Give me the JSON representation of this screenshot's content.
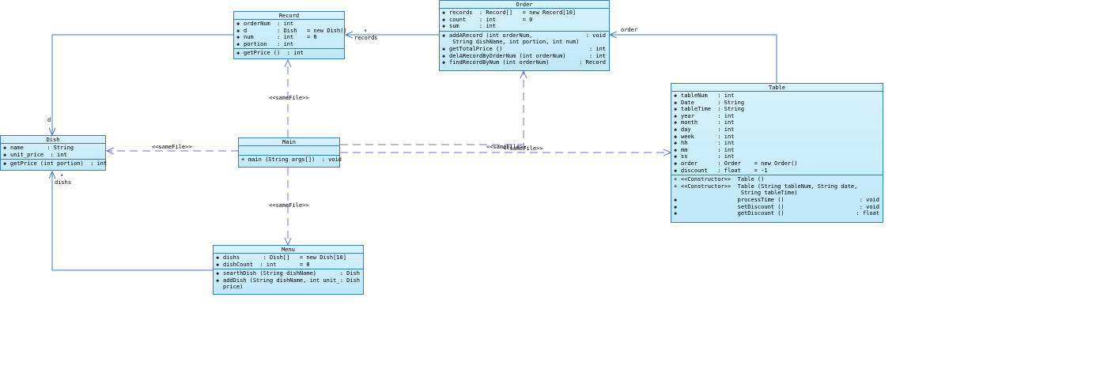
{
  "classes": {
    "record": {
      "name": "Record",
      "attrs": [
        {
          "vis": "◈",
          "text": "orderNum  : int"
        },
        {
          "vis": "◈",
          "text": "d         : Dish   = new Dish()"
        },
        {
          "vis": "◈",
          "text": "num       : int    = 0"
        },
        {
          "vis": "◈",
          "text": "portion   : int"
        }
      ],
      "ops": [
        {
          "vis": "◈",
          "text": "getPrice ()  : int"
        }
      ]
    },
    "order": {
      "name": "Order",
      "attrs": [
        {
          "vis": "◈",
          "text": "records  : Record[]   = new Record[10]"
        },
        {
          "vis": "◈",
          "text": "count    : int        = 0"
        },
        {
          "vis": "◈",
          "text": "sum      : int"
        }
      ],
      "ops": [
        {
          "vis": "◈",
          "text": "addARecord (int orderNum,",
          "ret": ": void"
        },
        {
          "vis": "",
          "text": " String dishName, int portion, int num)",
          "ret": ""
        },
        {
          "vis": "◈",
          "text": "getTotalPrice ()",
          "ret": ": int"
        },
        {
          "vis": "◈",
          "text": "delARecordByOrderNum (int orderNum)",
          "ret": ": int"
        },
        {
          "vis": "◈",
          "text": "findRecordByNum (int orderNum)",
          "ret": ": Record"
        }
      ]
    },
    "dish": {
      "name": "Dish",
      "attrs": [
        {
          "vis": "◈",
          "text": "name       : String"
        },
        {
          "vis": "◈",
          "text": "unit_price  : int"
        }
      ],
      "ops": [
        {
          "vis": "◈",
          "text": "getPrice (int portion)  : int"
        }
      ]
    },
    "main": {
      "name": "Main",
      "attrs": [],
      "ops": [
        {
          "vis": "+",
          "text": "main (String args[])  : void"
        }
      ]
    },
    "menu": {
      "name": "Menu",
      "attrs": [
        {
          "vis": "◈",
          "text": "dishs       : Dish[]   = new Dish[10]"
        },
        {
          "vis": "◈",
          "text": "dishCount  : int       = 0"
        }
      ],
      "ops": [
        {
          "vis": "◈",
          "text": "searthDish (String dishName)",
          "ret": ": Dish"
        },
        {
          "vis": "◈",
          "text": "addDish (String dishName, int unit_",
          "ret": ": Dish"
        },
        {
          "vis": "",
          "text": "price)",
          "ret": ""
        }
      ]
    },
    "table": {
      "name": "Table",
      "attrs": [
        {
          "vis": "◈",
          "text": "tableNum   : int"
        },
        {
          "vis": "◈",
          "text": "Date       : String"
        },
        {
          "vis": "◈",
          "text": "tableTime  : String"
        },
        {
          "vis": "◈",
          "text": "year       : int"
        },
        {
          "vis": "◈",
          "text": "month      : int"
        },
        {
          "vis": "◈",
          "text": "day        : int"
        },
        {
          "vis": "◈",
          "text": "week       : int"
        },
        {
          "vis": "◈",
          "text": "hh         : int"
        },
        {
          "vis": "◈",
          "text": "mm         : int"
        },
        {
          "vis": "◈",
          "text": "ss         : int"
        },
        {
          "vis": "◈",
          "text": "order      : Order    = new Order()"
        },
        {
          "vis": "◈",
          "text": "discount   : float    = -1"
        }
      ],
      "ops": [
        {
          "vis": "+",
          "text": "<<Constructor>>  Table ()",
          "ret": ""
        },
        {
          "vis": "+",
          "text": "<<Constructor>>  Table (String tableNum, String date,",
          "ret": ""
        },
        {
          "vis": "",
          "text": "                  String tableTime)",
          "ret": ""
        },
        {
          "vis": "◈",
          "text": "                 processTime ()",
          "ret": ": void"
        },
        {
          "vis": "◈",
          "text": "                 setDiscount ()",
          "ret": ": void"
        },
        {
          "vis": "◈",
          "text": "                 getDiscount ()",
          "ret": ": float"
        }
      ]
    }
  },
  "labels": {
    "records_mult": "*",
    "records_role": "records",
    "order_role": "order",
    "d_role": "d",
    "dishs_mult": "*",
    "dishs_role": "dishs",
    "samefile_record": "<<sameFile>>",
    "samefile_dish": "<<sameFile>>",
    "samefile_menu": "<<sameFile>>",
    "samefile_order": "<<sameFile>>",
    "samefile_table": "<<sameFile>>"
  },
  "colors": {
    "line": "#3a7bbf",
    "dashed": "#6b74d6",
    "box_top": "#d7f2fc",
    "box_bottom": "#bfe8fa"
  }
}
